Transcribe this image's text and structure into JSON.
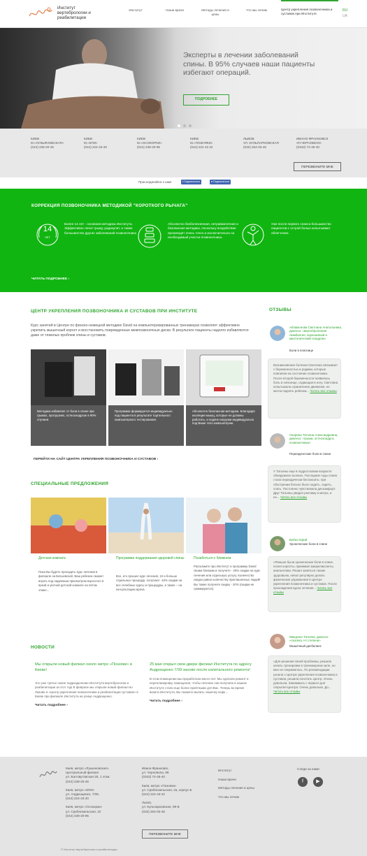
{
  "header": {
    "logo_text": "Институт вертебрологии и реабилитации",
    "nav": [
      "Институт",
      "Наши врачи",
      "Методы лечения и цены",
      "Что мы лечим"
    ],
    "nav_active": "Центр укрепления позвоночника и суставов при Институте",
    "lang": [
      "RU",
      "UA"
    ]
  },
  "hero": {
    "title": "Эксперты в лечении заболеваний спины. В 95% случаев наши пациенты избегают операций.",
    "button": "ПОДРОБНЕЕ"
  },
  "locations": [
    {
      "city": "КИЕВ",
      "metro": "М.«ЛУКЬЯНОВСКАЯ»",
      "phone": "(044) 238-20-45"
    },
    {
      "city": "КИЕВ",
      "metro": "М.«КПИ»",
      "phone": "(044) 224-43-20"
    },
    {
      "city": "КИЕВ",
      "metro": "М.«ОСОКОРКИ»",
      "phone": "(044) 238-20-95"
    },
    {
      "city": "КИЕВ",
      "metro": "М.«ПОЗНЯКИ»",
      "phone": "(044) 224 43 22"
    },
    {
      "city": "ЛЬВОВ",
      "metro": "УЛ. КУЛЬПАРКОВСКАЯ",
      "phone": "(032) 254-03-46"
    },
    {
      "city": "ИВАНО-ФРАНКОВСК",
      "metro": "УЛ.ЧЕРНОВОЛА",
      "phone": "(0342) 74-45-40"
    }
  ],
  "callback_button": "ПЕРЕЗВОНИТЕ МНЕ",
  "social": {
    "join_text": "Присоединяйся к нам!",
    "btn": "Подписаться"
  },
  "method": {
    "title": "КОРРЕКЦИЯ ПОЗВОНОЧНИКА МЕТОДИКОЙ \"КОРОТКОГО РЫЧАГА\"",
    "badge_number": "14",
    "badge_label": "ЛЕТ",
    "items": [
      "Более 14 лет - основная методика Института. Эффективно лечит грыжу, радикулит, а также большинство других заболеваний позвоночника",
      "Абсолютно безболезненная, нетравматичная и безопасная методика, поскольку воздействие производят очень точно и исключительно на необходимый участок позвоночника.",
      "Уже после первого сеанса большинство пациентов с острой болью испытывают облегчение."
    ],
    "read_more": "ЧИТАТЬ ПОДРОБНЕЕ"
  },
  "center": {
    "title": "ЦЕНТР УКРЕПЛЕНИЯ ПОЗВОНОЧНИКА И СУСТАВОВ ПРИ ИНСТИТУТЕ",
    "desc": "Курс занятий в Центре по финско-немецкой методике David на компьютеризированных тренажерах позволяет эффективно укрепить мышечный корсет и восстановить поврежденные межпозвоночные диски. В результате пациенты надолго избавляются даже от тяжелых проблем спины и суставов.",
    "cards": [
      "Методика избавляет от боли в спине при грыжах, протрузиях, остеохондрозе в 90% случаев.",
      "Программа формируется индивидуально под пациента в результате тщательного компьютерного тестирования.",
      "Абсолютно безопасная методика. Благодаря изоляции мышц, которые не должны работать, и подаче нагрузки индивидуально под Ваше тело компьютером."
    ],
    "goto": "ПЕРЕЙТИ НА САЙТ ЦЕНТРА УКРЕПЛЕНИЯ ПОЗВОНОЧНИКА И СУСТАВОВ"
  },
  "offers": {
    "title": "СПЕЦИАЛЬНЫЕ ПРЕДЛОЖЕНИЯ",
    "items": [
      {
        "title": "Детская комната",
        "text": "Пока Вы будете проходить курс лечения в филиале на Батыевской, Ваш ребенок сможет играть под надежным присмотром взрослого в яркой и уютной детской комнате на пятом этаже..."
      },
      {
        "title": "Программа поддержания здоровой спины",
        "text": "Все, кто прошел курс лечения, 10 и больше отдельных процедур, получают -10% скидки на все лечебные курсы и процедуры, а также – на консультацию врача."
      },
      {
        "title": "Позаботься о ближнем",
        "text": "Расскажите про Институт и программу David своим близким и получите - 20% скидки на курс лечения или отдельную услугу. Количество скидок равно количеству приглашенных людей! Вы также получите скидку - 20% (скидки не суммируются)."
      }
    ]
  },
  "reviews": {
    "title": "ОТЗЫВЫ",
    "items": [
      {
        "name": "Абламонова Светлана Анатольевна, диагноз: «вертеброгенная люмбалгия, корешковый и миотонический синдром»",
        "diag": "Боли в пояснице",
        "text": "Возникновение болезни Светлана связывает с беременностью и родами, которые повлияли на состояние позвоночника. После второй беременности появилась боль в пояснице, отдающая в ногу. Светлана испытывала ограничение движения, не могла поднять ребенка...",
        "more": "Читать все отзывы"
      },
      {
        "name": "Сворина Татьяна Александровна, диагноз: «грыжа, остеохондроз позвоночника»",
        "diag": "Периодические боли в спине",
        "text": "У Татьяны еще в подростковом возрасте обнаружили сколиоз. Последние годы спина стала периодически беспокоить: при обострении больно было ходить, сидеть, спать. Постоянно чувствовала дискомфорт. Друг Татьяны увидел рекламу в метро, и ее...",
        "more": "Читать все отзывы"
      },
      {
        "name": "Бебко Юрий",
        "diag": "Хронические боли в спине",
        "text": "«Раньше были хронические боли в спине, носил корсеты, принимал миорелаксанты, анальгетики. Решил заняться своим здоровьем, начал регулярно делать физические упражнения в Центре укрепления позвоночника и суставов. После прохождения курса лечения...",
        "more": "Читать все отзывы"
      },
      {
        "name": "Мищенко Татьяна, диагноз: «сколиоз I-II степени»",
        "diag": "Мышечный дисбаланс",
        "text": "«Для решения своей проблемы, решила начать тренировки в тренажерном зале, но мне не понравилось. По рекомендации узнала о Центре укрепления позвоночника и суставов, решила посетить Центр. Очень довольна. Занимаюсь с первого дня открытия Центра. Очень довольна. До...",
        "more": "Читать все отзывы"
      }
    ]
  },
  "news": {
    "title": "НОВОСТИ",
    "items": [
      {
        "head": "Мы открыли новый филиал около метро «Позняки» в Киеве!",
        "body": "Это уже третье новое подразделение Института вертебрологии и реабилитации за этот год! В феврале мы открыли новый филиал во Львове и «Центр укрепления позвоночника и реабилитации суставов» в Киеве при филиале Института на улице Андрющенко.",
        "more": "Читать подробнее"
      },
      {
        "head": "25 мая открыл свои двери филиал Института по адресу Андрющенко 7/39 заново после капитального ремонта!",
        "body": "В этом помещении мы проработали много лет. Мы сделали ремонт и перепланировку помещения, чтобы лечение они получали в нашем Институте стали еще более приятными для Вас. Теперь во время визита Института, Вы сможете выпить чашечку кофе...",
        "more": "Читать подробнее"
      }
    ]
  },
  "footer": {
    "col1": [
      "Киев, метро «Лукьяновская»,",
      "Центральный филиал",
      "ул. Багговутовская 25, 1 этаж",
      "(044) 238-20-45",
      "",
      "Киев, метро «КПИ»",
      "ул. Андрющенко, 7/39,",
      "(044) 224-43-20",
      "",
      "Киев, метро «Осокорки»",
      "ул. Срибнокильская, 22",
      "(044) 238-20-95"
    ],
    "col2": [
      "Ивано-Франковск,",
      "ул. Черновола, 99",
      "(0342) 74-45-40",
      "",
      "Киев, метро «Позняки»",
      "ул. Срибнокильская, 2а, корпус Б",
      "(044) 224-43-22",
      "",
      "Львов,",
      "ул. Кульпарковская, 99-Б",
      "(032) 254-03-46"
    ],
    "col3": [
      "Институт",
      "Наши врачи",
      "Методы лечения и цены",
      "Что мы лечим"
    ],
    "follow": "Следи за нами",
    "callback": "ПЕРЕЗВОНИТЕ МНЕ",
    "copyright": "© Институт вертебрологии и реабилитации"
  }
}
